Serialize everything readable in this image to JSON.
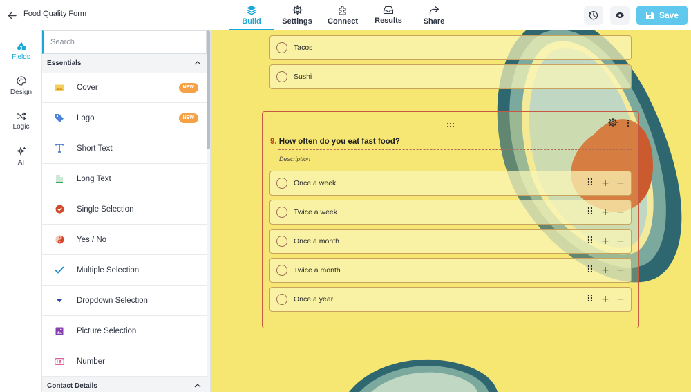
{
  "header": {
    "back_icon": "arrow-left-icon",
    "form_title": "Food Quality Form",
    "tabs": [
      {
        "label": "Build",
        "icon": "layers-icon",
        "active": true
      },
      {
        "label": "Settings",
        "icon": "gear-icon",
        "active": false
      },
      {
        "label": "Connect",
        "icon": "puzzle-icon",
        "active": false
      },
      {
        "label": "Results",
        "icon": "inbox-icon",
        "active": false
      },
      {
        "label": "Share",
        "icon": "share-arrow-icon",
        "active": false
      }
    ],
    "history_icon": "history-icon",
    "preview_icon": "eye-icon",
    "save_label": "Save",
    "save_icon": "floppy-disk-icon"
  },
  "rail": {
    "items": [
      {
        "label": "Fields",
        "icon": "shapes-icon",
        "active": true
      },
      {
        "label": "Design",
        "icon": "palette-icon",
        "active": false
      },
      {
        "label": "Logic",
        "icon": "shuffle-icon",
        "active": false
      },
      {
        "label": "AI",
        "icon": "sparkles-icon",
        "active": false
      }
    ]
  },
  "panel": {
    "search_placeholder": "Search",
    "sections": [
      {
        "title": "Essentials",
        "collapse_icon": "chevron-up-icon"
      },
      {
        "title": "Contact Details",
        "collapse_icon": "chevron-up-icon"
      }
    ],
    "fields": [
      {
        "label": "Cover",
        "icon": "cover-image-icon",
        "badge": "NEW"
      },
      {
        "label": "Logo",
        "icon": "tag-icon",
        "badge": "NEW"
      },
      {
        "label": "Short Text",
        "icon": "text-t-icon",
        "badge": ""
      },
      {
        "label": "Long Text",
        "icon": "paragraph-lines-icon",
        "badge": ""
      },
      {
        "label": "Single Selection",
        "icon": "check-circle-icon",
        "badge": ""
      },
      {
        "label": "Yes / No",
        "icon": "yin-yang-icon",
        "badge": ""
      },
      {
        "label": "Multiple Selection",
        "icon": "checkmark-icon",
        "badge": ""
      },
      {
        "label": "Dropdown Selection",
        "icon": "caret-down-icon",
        "badge": ""
      },
      {
        "label": "Picture Selection",
        "icon": "picture-icon",
        "badge": ""
      },
      {
        "label": "Number",
        "icon": "number-box-icon",
        "badge": ""
      }
    ]
  },
  "canvas": {
    "colors": {
      "background": "#f6e672",
      "accent": "#c33b22"
    },
    "prev_options": [
      "Tacos",
      "Sushi"
    ],
    "question": {
      "number": "9.",
      "title": "How often do you eat fast food?",
      "description": "Description",
      "options": [
        "Once a week",
        "Twice a week",
        "Once a month",
        "Twice a month",
        "Once a year"
      ]
    },
    "option_tools": {
      "drag": "⠿",
      "add": "+",
      "remove": "−"
    }
  }
}
